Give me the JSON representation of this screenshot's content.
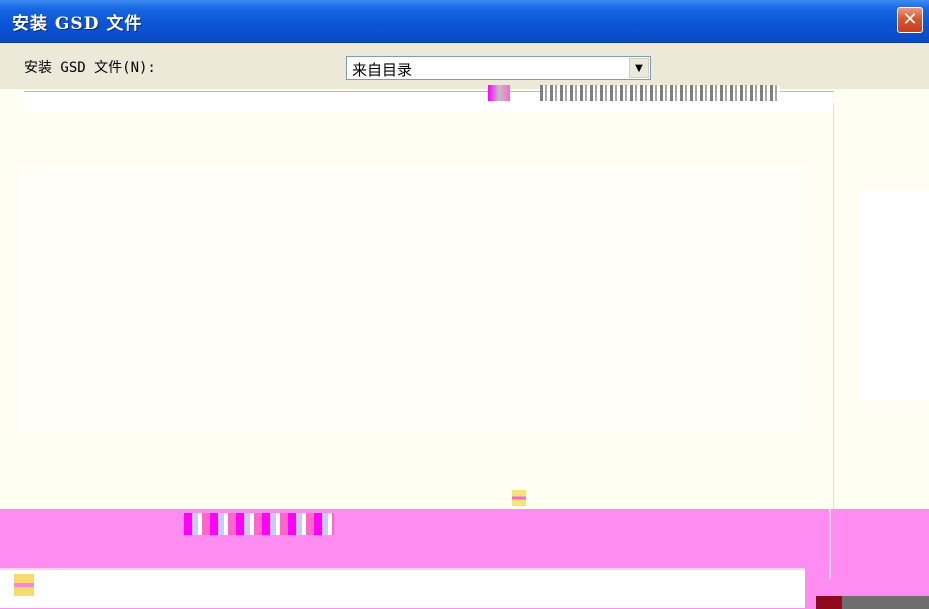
{
  "window": {
    "title": "安装 GSD 文件",
    "close_glyph": "✕"
  },
  "install_row": {
    "label": "安装 GSD 文件(N):",
    "selected_source": "来自目录",
    "dropdown_glyph": "▼"
  },
  "colors": {
    "titlebar": "#0c55d6",
    "close_button": "#d9552e",
    "dialog_face": "#ece9d8",
    "glitch_band": "#ff8cf0"
  },
  "icons": [
    "close-icon",
    "chevron-down-icon"
  ]
}
